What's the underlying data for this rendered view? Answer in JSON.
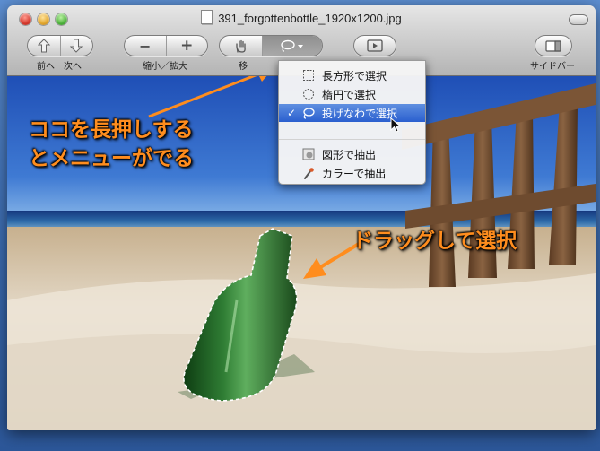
{
  "window": {
    "title": "391_forgottenbottle_1920x1200.jpg"
  },
  "toolbar": {
    "nav_label": "前へ　次へ",
    "zoom_label": "縮小／拡大",
    "select_label": "移",
    "sidebar_label": "サイドバー",
    "back_icon": "arrow-up-icon",
    "forward_icon": "arrow-down-icon",
    "zoom_out_glyph": "−",
    "zoom_in_glyph": "+"
  },
  "menu": {
    "items": [
      {
        "label": "長方形で選択",
        "icon": "rectangle-select-icon",
        "checked": false,
        "active": false
      },
      {
        "label": "楕円で選択",
        "icon": "ellipse-select-icon",
        "checked": false,
        "active": false
      },
      {
        "label": "投げなわで選択",
        "icon": "lasso-icon",
        "checked": true,
        "active": true
      },
      {
        "label": "図形で抽出",
        "icon": "shape-extract-icon",
        "checked": false,
        "active": false
      },
      {
        "label": "カラーで抽出",
        "icon": "color-extract-icon",
        "checked": false,
        "active": false
      }
    ],
    "check_glyph": "✓"
  },
  "annotations": {
    "long_press_line1": "ココを長押しする",
    "long_press_line2": "とメニューがでる",
    "drag": "ドラッグして選択"
  },
  "colors": {
    "callout": "#ff8d1e",
    "menu_highlight": "#2a5fcf"
  }
}
